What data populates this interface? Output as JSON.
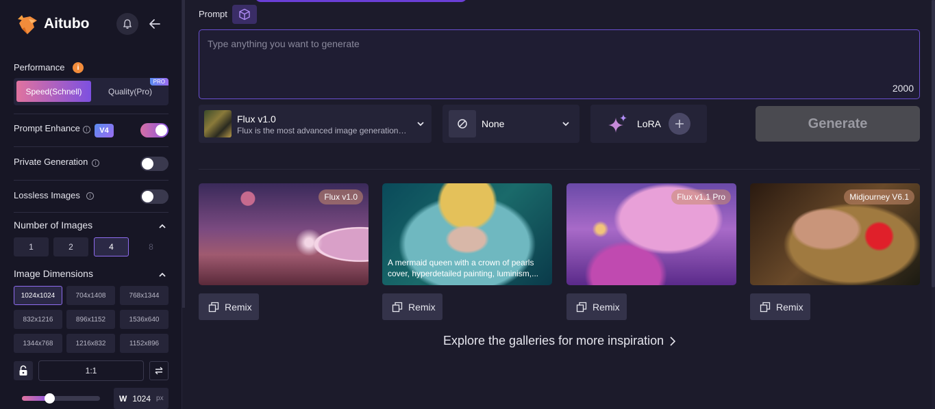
{
  "brand": {
    "name": "Aitubo"
  },
  "sidebar": {
    "performance": {
      "label": "Performance",
      "info_glyph": "i",
      "options": [
        {
          "label": "Speed(Schnell)",
          "selected": true
        },
        {
          "label": "Quality(Pro)",
          "selected": false,
          "badge": "PRO"
        }
      ]
    },
    "prompt_enhance": {
      "label": "Prompt Enhance",
      "badge": "V4",
      "enabled": true
    },
    "private_generation": {
      "label": "Private Generation",
      "enabled": false
    },
    "lossless_images": {
      "label": "Lossless Images",
      "enabled": false
    },
    "number_of_images": {
      "title": "Number of Images",
      "options": [
        {
          "label": "1",
          "state": "normal"
        },
        {
          "label": "2",
          "state": "normal"
        },
        {
          "label": "4",
          "state": "selected"
        },
        {
          "label": "8",
          "state": "disabled"
        }
      ]
    },
    "image_dimensions": {
      "title": "Image Dimensions",
      "options": [
        {
          "label": "1024x1024",
          "selected": true
        },
        {
          "label": "704x1408",
          "selected": false
        },
        {
          "label": "768x1344",
          "selected": false
        },
        {
          "label": "832x1216",
          "selected": false
        },
        {
          "label": "896x1152",
          "selected": false
        },
        {
          "label": "1536x640",
          "selected": false
        },
        {
          "label": "1344x768",
          "selected": false
        },
        {
          "label": "1216x832",
          "selected": false
        },
        {
          "label": "1152x896",
          "selected": false
        }
      ],
      "ratio": "1:1",
      "width": {
        "label": "W",
        "value": "1024",
        "unit": "px",
        "slider_fraction": 0.35
      }
    }
  },
  "main": {
    "prompt": {
      "label": "Prompt",
      "placeholder": "Type anything you want to generate",
      "char_count": "2000"
    },
    "model": {
      "name": "Flux v1.0",
      "description": "Flux is the most advanced image generation model"
    },
    "style": {
      "name": "None"
    },
    "lora": {
      "label": "LoRA"
    },
    "generate_label": "Generate",
    "gallery": [
      {
        "tag": "Flux v1.0",
        "caption": "",
        "remix": "Remix"
      },
      {
        "tag": "",
        "caption": "A mermaid queen with a crown of pearls cover, hyperdetailed painting, luminism,...",
        "remix": "Remix"
      },
      {
        "tag": "Flux v1.1 Pro",
        "caption": "",
        "remix": "Remix"
      },
      {
        "tag": "Midjourney V6.1",
        "caption": "",
        "remix": "Remix"
      }
    ],
    "explore_label": "Explore the galleries for more inspiration"
  },
  "colors": {
    "accent": "#8f6cf0",
    "background": "#1c1b2b",
    "sidebar": "#171625",
    "brand_orange": "#f28c3b"
  },
  "icons": [
    "fox-logo-icon",
    "bell-icon",
    "arrow-left-icon",
    "cube-icon",
    "ban-icon",
    "chevron-down-icon",
    "chevron-up-icon",
    "sparkles-icon",
    "plus-icon",
    "copy-icon",
    "lock-icon",
    "swap-icon",
    "chevron-right-icon"
  ]
}
